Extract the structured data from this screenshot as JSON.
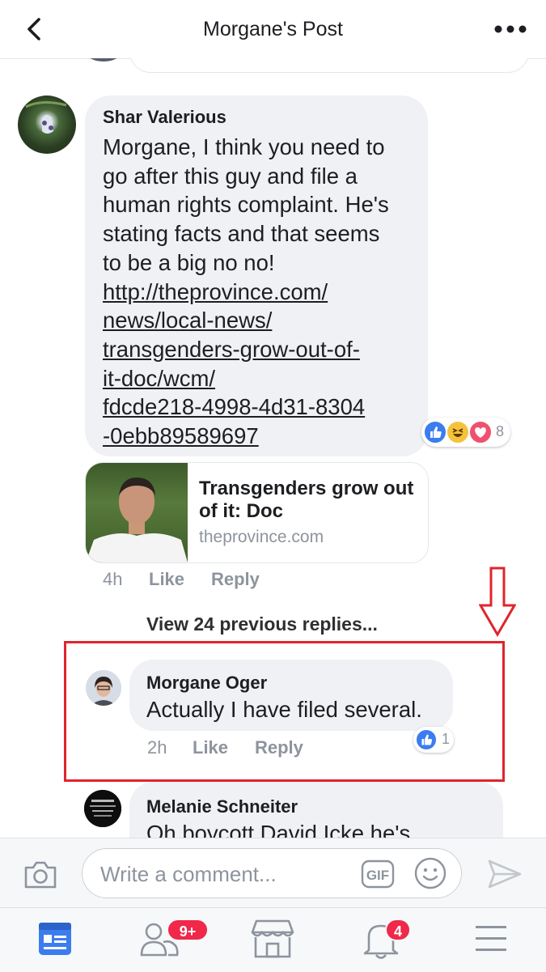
{
  "header": {
    "title": "Morgane's Post"
  },
  "comments": [
    {
      "author": "Shar Valerious",
      "text_lines": [
        "Morgane, I think you need to",
        "go after this guy and file a",
        "human rights complaint. He's",
        "stating facts and that seems",
        "to be a big no no!"
      ],
      "link_lines": [
        "http://theprovince.com/",
        "news/local-news/",
        "transgenders-grow-out-of-",
        "it-doc/wcm/",
        "fdcde218-4998-4d31-8304",
        "-0ebb89589697"
      ],
      "reaction_count": "8",
      "reaction_icons": [
        "like-icon",
        "haha-icon",
        "love-icon"
      ],
      "link_preview": {
        "title": "Transgenders grow out of it: Doc",
        "domain": "theprovince.com"
      },
      "time": "4h",
      "like_label": "Like",
      "reply_label": "Reply"
    }
  ],
  "view_previous_replies": "View 24 previous replies...",
  "replies": [
    {
      "author": "Morgane Oger",
      "text": "Actually I have filed several.",
      "time": "2h",
      "like_label": "Like",
      "reply_label": "Reply",
      "reaction_count": "1"
    },
    {
      "author": "Melanie Schneiter",
      "text": "Oh boycott David Icke he's"
    }
  ],
  "annotation": {
    "color": "#e0242c"
  },
  "composer": {
    "placeholder": "Write a comment...",
    "gif_label": "GIF"
  },
  "tabbar": {
    "tabs": [
      "news-feed-icon",
      "friends-icon",
      "marketplace-icon",
      "notifications-icon",
      "menu-icon"
    ],
    "friends_badge": "9+",
    "notifications_badge": "4"
  },
  "colors": {
    "accent": "#3b7cf0",
    "badge": "#f02849",
    "bubble": "#f0f1f4",
    "muted": "#8d949e"
  }
}
